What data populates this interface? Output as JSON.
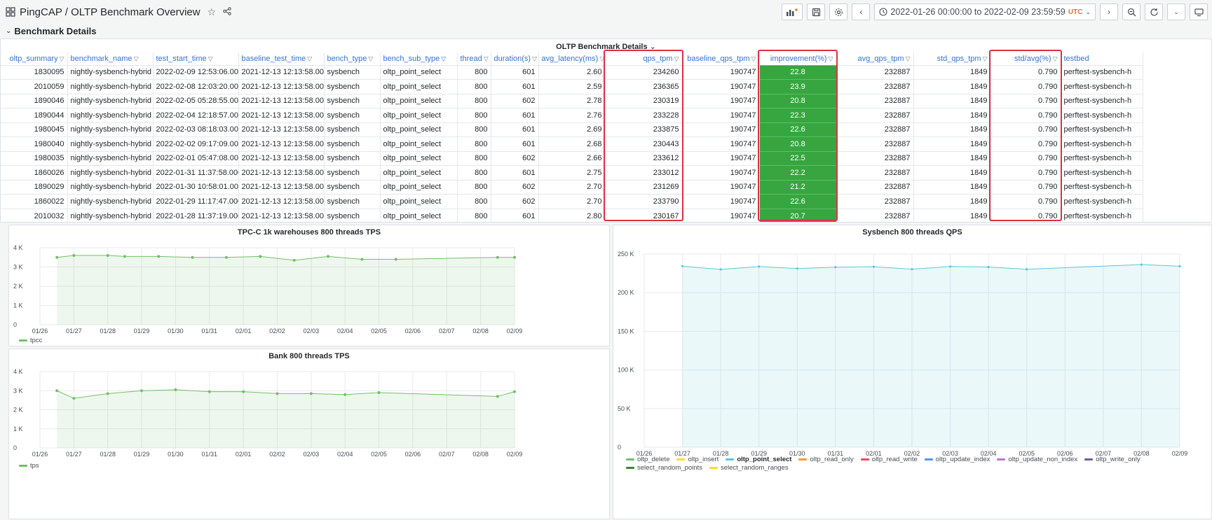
{
  "topbar": {
    "title": "PingCAP / OLTP Benchmark Overview",
    "time_range": "2022-01-26 00:00:00 to 2022-02-09 23:59:59",
    "timezone": "UTC"
  },
  "section": {
    "label": "Benchmark Details"
  },
  "table_panel": {
    "title": "OLTP Benchmark Details",
    "columns": [
      {
        "key": "oltp_summary",
        "label": "oltp_summary"
      },
      {
        "key": "benchmark_name",
        "label": "benchmark_name"
      },
      {
        "key": "test_start_time",
        "label": "test_start_time"
      },
      {
        "key": "baseline_test_time",
        "label": "baseline_test_time"
      },
      {
        "key": "bench_type",
        "label": "bench_type"
      },
      {
        "key": "bench_sub_type",
        "label": "bench_sub_type"
      },
      {
        "key": "thread",
        "label": "thread"
      },
      {
        "key": "duration",
        "label": "duration(s)"
      },
      {
        "key": "avg_latency",
        "label": "avg_latency(ms)"
      },
      {
        "key": "qps_tpm",
        "label": "qps_tpm"
      },
      {
        "key": "baseline_qps_tpm",
        "label": "baseline_qps_tpm"
      },
      {
        "key": "improvement",
        "label": "improvement(%)"
      },
      {
        "key": "avg_qps_tpm",
        "label": "avg_qps_tpm"
      },
      {
        "key": "std_qps_tpm",
        "label": "std_qps_tpm"
      },
      {
        "key": "std_avg",
        "label": "std/avg(%)"
      },
      {
        "key": "testbed",
        "label": "testbed"
      }
    ],
    "rows": [
      [
        "1830095",
        "nightly-sysbench-hybrid",
        "2022-02-09 12:53:06.000",
        "2021-12-13 12:13:58.000",
        "sysbench",
        "oltp_point_select",
        "800",
        "601",
        "2.60",
        "234260",
        "190747",
        "22.8",
        "232887",
        "1849",
        "0.790",
        "perftest-sysbench-h"
      ],
      [
        "2010059",
        "nightly-sysbench-hybrid",
        "2022-02-08 12:03:20.000",
        "2021-12-13 12:13:58.000",
        "sysbench",
        "oltp_point_select",
        "800",
        "601",
        "2.59",
        "236365",
        "190747",
        "23.9",
        "232887",
        "1849",
        "0.790",
        "perftest-sysbench-h"
      ],
      [
        "1890046",
        "nightly-sysbench-hybrid",
        "2022-02-05 05:28:55.000",
        "2021-12-13 12:13:58.000",
        "sysbench",
        "oltp_point_select",
        "800",
        "602",
        "2.78",
        "230319",
        "190747",
        "20.8",
        "232887",
        "1849",
        "0.790",
        "perftest-sysbench-h"
      ],
      [
        "1890044",
        "nightly-sysbench-hybrid",
        "2022-02-04 12:18:57.000",
        "2021-12-13 12:13:58.000",
        "sysbench",
        "oltp_point_select",
        "800",
        "601",
        "2.76",
        "233228",
        "190747",
        "22.3",
        "232887",
        "1849",
        "0.790",
        "perftest-sysbench-h"
      ],
      [
        "1980045",
        "nightly-sysbench-hybrid",
        "2022-02-03 08:18:03.000",
        "2021-12-13 12:13:58.000",
        "sysbench",
        "oltp_point_select",
        "800",
        "601",
        "2.69",
        "233875",
        "190747",
        "22.6",
        "232887",
        "1849",
        "0.790",
        "perftest-sysbench-h"
      ],
      [
        "1980040",
        "nightly-sysbench-hybrid",
        "2022-02-02 09:17:09.000",
        "2021-12-13 12:13:58.000",
        "sysbench",
        "oltp_point_select",
        "800",
        "601",
        "2.68",
        "230443",
        "190747",
        "20.8",
        "232887",
        "1849",
        "0.790",
        "perftest-sysbench-h"
      ],
      [
        "1980035",
        "nightly-sysbench-hybrid",
        "2022-02-01 05:47:08.000",
        "2021-12-13 12:13:58.000",
        "sysbench",
        "oltp_point_select",
        "800",
        "602",
        "2.66",
        "233612",
        "190747",
        "22.5",
        "232887",
        "1849",
        "0.790",
        "perftest-sysbench-h"
      ],
      [
        "1860026",
        "nightly-sysbench-hybrid",
        "2022-01-31 11:37:58.000",
        "2021-12-13 12:13:58.000",
        "sysbench",
        "oltp_point_select",
        "800",
        "601",
        "2.75",
        "233012",
        "190747",
        "22.2",
        "232887",
        "1849",
        "0.790",
        "perftest-sysbench-h"
      ],
      [
        "1890029",
        "nightly-sysbench-hybrid",
        "2022-01-30 10:58:01.000",
        "2021-12-13 12:13:58.000",
        "sysbench",
        "oltp_point_select",
        "800",
        "602",
        "2.70",
        "231269",
        "190747",
        "21.2",
        "232887",
        "1849",
        "0.790",
        "perftest-sysbench-h"
      ],
      [
        "1860022",
        "nightly-sysbench-hybrid",
        "2022-01-29 11:17:47.000",
        "2021-12-13 12:13:58.000",
        "sysbench",
        "oltp_point_select",
        "800",
        "602",
        "2.70",
        "233790",
        "190747",
        "22.6",
        "232887",
        "1849",
        "0.790",
        "perftest-sysbench-h"
      ],
      [
        "2010032",
        "nightly-sysbench-hybrid",
        "2022-01-28 11:37:19.000",
        "2021-12-13 12:13:58.000",
        "sysbench",
        "oltp_point_select",
        "800",
        "601",
        "2.80",
        "230167",
        "190747",
        "20.7",
        "232887",
        "1849",
        "0.790",
        "perftest-sysbench-h"
      ]
    ]
  },
  "colors": {
    "tpcc": "#73bf69",
    "qps": "#5bc7d8",
    "improvement_cell": "#37a640",
    "highlight": "#e02f44"
  },
  "chart_data": [
    {
      "type": "line",
      "title": "TPC-C 1k warehouses 800 threads TPS",
      "x": [
        "2022-01-26T12:00",
        "2022-01-27T00:00",
        "2022-01-28T00:00",
        "2022-01-28T12:00",
        "2022-01-29T12:00",
        "2022-01-30T12:00",
        "2022-01-31T12:00",
        "2022-02-01T12:00",
        "2022-02-02T12:00",
        "2022-02-03T12:00",
        "2022-02-04T12:00",
        "2022-02-05T12:00",
        "2022-02-08T12:00",
        "2022-02-09T00:00"
      ],
      "series": [
        {
          "name": "tpcc",
          "values": [
            3500,
            3600,
            3600,
            3550,
            3550,
            3500,
            3500,
            3550,
            3350,
            3550,
            3400,
            3400,
            3500,
            3500
          ]
        }
      ],
      "x_ticks": [
        "01/26",
        "01/27",
        "01/28",
        "01/29",
        "01/30",
        "01/31",
        "02/01",
        "02/02",
        "02/03",
        "02/04",
        "02/05",
        "02/06",
        "02/07",
        "02/08",
        "02/09"
      ],
      "y_ticks": [
        "0",
        "1 K",
        "2 K",
        "3 K",
        "4 K"
      ],
      "ylim": [
        0,
        4000
      ],
      "legend": [
        "tpcc"
      ]
    },
    {
      "type": "line",
      "title": "Bank 800 threads TPS",
      "x": [
        "2022-01-26T12:00",
        "2022-01-27T00:00",
        "2022-01-28T00:00",
        "2022-01-29T00:00",
        "2022-01-30T00:00",
        "2022-01-31T00:00",
        "2022-02-01T00:00",
        "2022-02-02T00:00",
        "2022-02-03T00:00",
        "2022-02-04T00:00",
        "2022-02-05T00:00",
        "2022-02-08T12:00",
        "2022-02-09T00:00"
      ],
      "series": [
        {
          "name": "tps",
          "values": [
            3000,
            2600,
            2850,
            3000,
            3050,
            2950,
            2950,
            2850,
            2850,
            2800,
            2900,
            2700,
            2950
          ]
        }
      ],
      "x_ticks": [
        "01/26",
        "01/27",
        "01/28",
        "01/29",
        "01/30",
        "01/31",
        "02/01",
        "02/02",
        "02/03",
        "02/04",
        "02/05",
        "02/06",
        "02/07",
        "02/08",
        "02/09"
      ],
      "y_ticks": [
        "0",
        "1 K",
        "2 K",
        "3 K",
        "4 K"
      ],
      "ylim": [
        0,
        4000
      ],
      "legend": [
        "tps"
      ]
    },
    {
      "type": "area",
      "title": "Sysbench 800 threads QPS",
      "x": [
        "2022-01-27T00:00",
        "2022-01-28T00:00",
        "2022-01-29T00:00",
        "2022-01-30T00:00",
        "2022-01-31T00:00",
        "2022-02-01T00:00",
        "2022-02-02T00:00",
        "2022-02-03T00:00",
        "2022-02-04T00:00",
        "2022-02-05T00:00",
        "2022-02-08T00:00",
        "2022-02-09T00:00"
      ],
      "series": [
        {
          "name": "oltp_point_select",
          "values": [
            234260,
            230167,
            233790,
            231269,
            233012,
            233612,
            230443,
            233875,
            233228,
            230319,
            236365,
            234260
          ]
        }
      ],
      "x_ticks": [
        "01/26",
        "01/27",
        "01/28",
        "01/29",
        "01/30",
        "01/31",
        "02/01",
        "02/02",
        "02/03",
        "02/04",
        "02/05",
        "02/06",
        "02/07",
        "02/08",
        "02/09"
      ],
      "y_ticks": [
        "0",
        "50 K",
        "100 K",
        "150 K",
        "200 K",
        "250 K"
      ],
      "ylim": [
        0,
        250000
      ],
      "legend": [
        {
          "name": "oltp_delete",
          "color": "#73bf69"
        },
        {
          "name": "oltp_insert",
          "color": "#fade2a"
        },
        {
          "name": "oltp_point_select",
          "color": "#5bc7d8"
        },
        {
          "name": "oltp_read_only",
          "color": "#ff9830"
        },
        {
          "name": "oltp_read_write",
          "color": "#f2495c"
        },
        {
          "name": "oltp_update_index",
          "color": "#5794f2"
        },
        {
          "name": "oltp_update_non_index",
          "color": "#b877d9"
        },
        {
          "name": "oltp_write_only",
          "color": "#705da0"
        },
        {
          "name": "select_random_points",
          "color": "#37872d"
        },
        {
          "name": "select_random_ranges",
          "color": "#fade2a"
        }
      ]
    }
  ]
}
